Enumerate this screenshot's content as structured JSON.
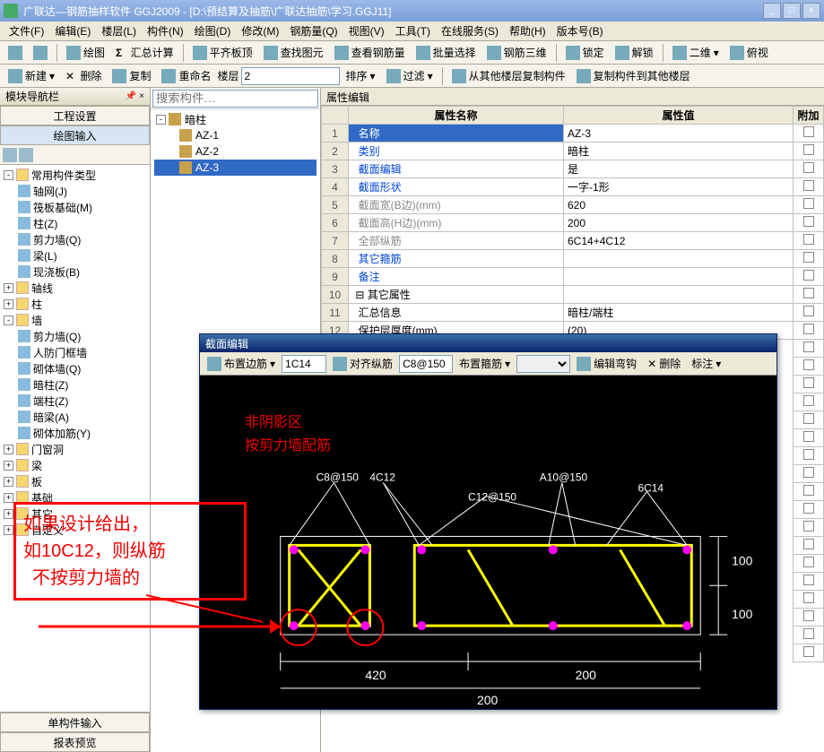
{
  "title": "广联达—钢筋抽样软件 GGJ2009 - [D:\\预结算及抽筋\\广联达抽筋\\学习.GGJ11]",
  "menu": [
    "文件(F)",
    "编辑(E)",
    "楼层(L)",
    "构件(N)",
    "绘图(D)",
    "修改(M)",
    "钢筋量(Q)",
    "视图(V)",
    "工具(T)",
    "在线服务(S)",
    "帮助(H)",
    "版本号(B)"
  ],
  "toolbar1": {
    "draw": "绘图",
    "summary": "汇总计算",
    "plan": "平齐板顶",
    "find": "查找图元",
    "rebar": "查看钢筋量",
    "batch": "批量选择",
    "tri": "钢筋三维",
    "lock": "锁定",
    "unlock": "解锁",
    "two": "二维",
    "threeD": "俯视"
  },
  "toolbar2": {
    "new": "新建",
    "del": "删除",
    "copy": "复制",
    "rename": "重命名",
    "floor_lbl": "楼层",
    "floor_val": "2",
    "sort": "排序",
    "filter": "过滤",
    "copyfrom": "从其他楼层复制构件",
    "copyto": "复制构件到其他楼层"
  },
  "sidebar": {
    "nav_title": "模块导航栏",
    "panel_eng": "工程设置",
    "panel_draw": "绘图输入",
    "panel_single": "单构件输入",
    "panel_report": "报表预览",
    "tree": {
      "root": "常用构件类型",
      "items": [
        "轴网(J)",
        "筏板基础(M)",
        "柱(Z)",
        "剪力墙(Q)",
        "梁(L)",
        "现浇板(B)"
      ],
      "groups": [
        "轴线",
        "柱",
        "墙"
      ],
      "wall_items": [
        "剪力墙(Q)",
        "人防门框墙",
        "砌体墙(Q)",
        "暗柱(Z)",
        "端柱(Z)",
        "暗梁(A)",
        "砌体加筋(Y)"
      ],
      "others": [
        "门窗洞",
        "梁",
        "板",
        "基础",
        "其它",
        "自定义"
      ]
    }
  },
  "center": {
    "search_ph": "搜索构件…",
    "root": "暗柱",
    "items": [
      "AZ-1",
      "AZ-2",
      "AZ-3"
    ],
    "selected": "AZ-3"
  },
  "prop": {
    "title": "属性编辑",
    "col_name": "属性名称",
    "col_val": "属性值",
    "col_attach": "附加",
    "rows": [
      {
        "n": "1",
        "name": "名称",
        "val": "AZ-3",
        "sel": true,
        "blue": true
      },
      {
        "n": "2",
        "name": "类别",
        "val": "暗柱",
        "blue": true
      },
      {
        "n": "3",
        "name": "截面编辑",
        "val": "是",
        "blue": true
      },
      {
        "n": "4",
        "name": "截面形状",
        "val": "一字-1形",
        "blue": true
      },
      {
        "n": "5",
        "name": "截面宽(B边)(mm)",
        "val": "620",
        "gray": true
      },
      {
        "n": "6",
        "name": "截面高(H边)(mm)",
        "val": "200",
        "gray": true
      },
      {
        "n": "7",
        "name": "全部纵筋",
        "val": "6C14+4C12",
        "gray": true
      },
      {
        "n": "8",
        "name": "其它箍筋",
        "val": "",
        "blue": true
      },
      {
        "n": "9",
        "name": "备注",
        "val": "",
        "blue": true
      },
      {
        "n": "10",
        "name": "其它属性",
        "val": "",
        "group": true
      },
      {
        "n": "11",
        "name": "汇总信息",
        "val": "暗柱/端柱"
      },
      {
        "n": "12",
        "name": "保护层厚度(mm)",
        "val": "(20)"
      }
    ]
  },
  "section": {
    "title": "截面编辑",
    "tb": {
      "edge": "布置边筋",
      "edge_val": "1C14",
      "align": "对齐纵筋",
      "align_val": "C8@150",
      "stir": "布置箍筋",
      "hook": "编辑弯钩",
      "del": "删除",
      "note": "标注"
    },
    "labels": {
      "c8": "C8@150",
      "c4": "4C12",
      "c12": "C12@150",
      "a10": "A10@150",
      "c6": "6C14"
    },
    "dims": {
      "w1": "420",
      "w2": "200",
      "w3": "200",
      "h1": "100",
      "h2": "100"
    }
  },
  "anno": {
    "hint1": "非阴影区",
    "hint2": "按剪力墙配筋",
    "box1a": "如果设计给出，",
    "box1b": "如10C12，则纵筋",
    "box1c": "不按剪力墙的"
  }
}
